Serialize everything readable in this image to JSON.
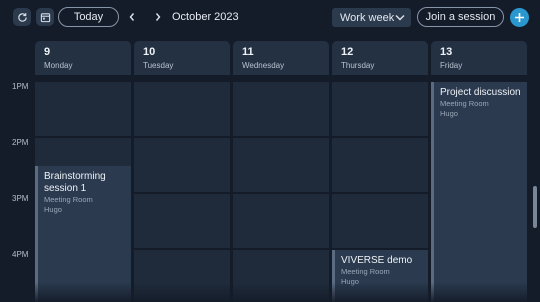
{
  "toolbar": {
    "refresh_icon": "refresh-icon",
    "calendar_icon": "calendar-icon",
    "today_label": "Today",
    "month_label": "October 2023",
    "view_label": "Work week",
    "join_label": "Join a session",
    "add_icon": "plus-icon",
    "accent": "#2a97cf"
  },
  "days": [
    {
      "num": "9",
      "name": "Monday"
    },
    {
      "num": "10",
      "name": "Tuesday"
    },
    {
      "num": "11",
      "name": "Wednesday"
    },
    {
      "num": "12",
      "name": "Thursday"
    },
    {
      "num": "13",
      "name": "Friday"
    }
  ],
  "times": [
    "1PM",
    "2PM",
    "3PM",
    "4PM"
  ],
  "events": [
    {
      "title": "Brainstorming session 1",
      "location": "Meeting Room",
      "owner": "Hugo",
      "day": "Monday",
      "start": "2:30PM"
    },
    {
      "title": "VIVERSE demo",
      "location": "Meeting Room",
      "owner": "Hugo",
      "day": "Thursday",
      "start": "4PM"
    },
    {
      "title": "Project discussion",
      "location": "Meeting Room",
      "owner": "Hugo",
      "day": "Friday",
      "start": "1PM"
    }
  ]
}
